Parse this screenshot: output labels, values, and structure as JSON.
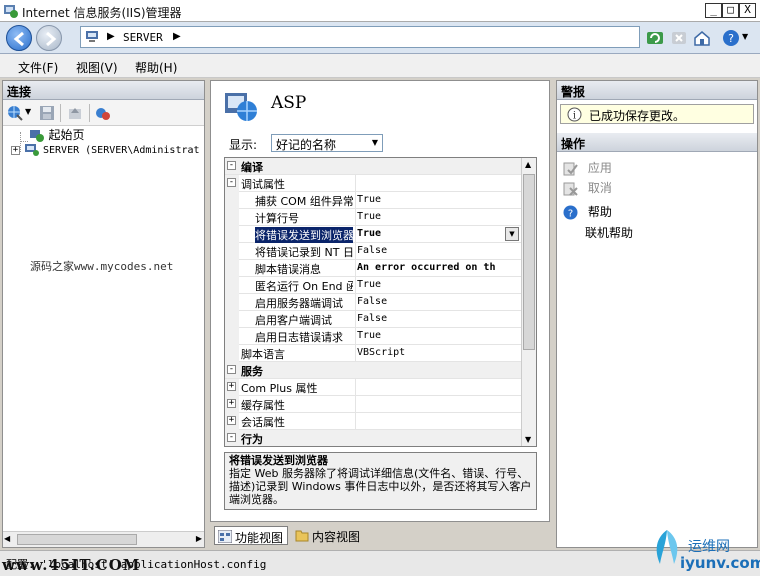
{
  "window": {
    "title": "Internet 信息服务(IIS)管理器",
    "min": "_",
    "max": "□",
    "close": "X"
  },
  "address": {
    "path": "SERVER"
  },
  "menu": [
    "文件(F)",
    "视图(V)",
    "帮助(H)"
  ],
  "connections": {
    "header": "连接",
    "items": [
      {
        "label": "起始页"
      },
      {
        "expander": "+",
        "label": "SERVER (SERVER\\Administrat"
      }
    ]
  },
  "watermark_center": "源码之家www.mycodes.net",
  "feature": {
    "title": "ASP",
    "display_label": "显示:",
    "display_value": "好记的名称",
    "rows": [
      {
        "type": "cat",
        "pm": "⊟",
        "name": "编译"
      },
      {
        "type": "sub",
        "pm": "⊟",
        "name": "调试属性"
      },
      {
        "type": "prop",
        "name": "捕获 COM 组件异常",
        "value": "True"
      },
      {
        "type": "prop",
        "name": "计算行号",
        "value": "True"
      },
      {
        "type": "sel",
        "name": "将错误发送到浏览器",
        "value": "True"
      },
      {
        "type": "prop",
        "name": "将错误记录到 NT 日",
        "value": "False"
      },
      {
        "type": "prop",
        "name": "脚本错误消息",
        "value": "An error occurred on th"
      },
      {
        "type": "prop",
        "name": "匿名运行 On End 函",
        "value": "True"
      },
      {
        "type": "prop",
        "name": "启用服务器端调试",
        "value": "False"
      },
      {
        "type": "prop",
        "name": "启用客户端调试",
        "value": "False"
      },
      {
        "type": "prop",
        "name": "启用日志错误请求",
        "value": "True"
      },
      {
        "type": "sub0",
        "name": "脚本语言",
        "value": "VBScript"
      },
      {
        "type": "cat",
        "pm": "⊟",
        "name": "服务"
      },
      {
        "type": "sub",
        "pm": "⊞",
        "name": "Com Plus 属性"
      },
      {
        "type": "sub",
        "pm": "⊞",
        "name": "缓存属性"
      },
      {
        "type": "sub",
        "pm": "⊞",
        "name": "会话属性"
      },
      {
        "type": "cat",
        "pm": "⊟",
        "name": "行为"
      }
    ],
    "desc_title": "将错误发送到浏览器",
    "desc_text": "指定 Web 服务器除了将调试详细信息(文件名、错误、行号、描述)记录到 Windows 事件日志中以外，是否还将其写入客户端浏览器。"
  },
  "view_tabs": {
    "features": "功能视图",
    "content": "内容视图"
  },
  "alerts": {
    "header": "警报",
    "message": "已成功保存更改。"
  },
  "actions": {
    "header": "操作",
    "apply": "应用",
    "cancel": "取消",
    "help": "帮助",
    "online_help": "联机帮助"
  },
  "status": {
    "text": "配置: 'localhost' applicationHost.config"
  },
  "watermarks": {
    "left": "www.45IT.COM",
    "right_cn": "运维网",
    "right_url": "iyunv.com"
  },
  "colors": {
    "selection": "#0a246a",
    "alert_bg": "#ffffe1",
    "nav_blue": "#2a6fcb"
  }
}
